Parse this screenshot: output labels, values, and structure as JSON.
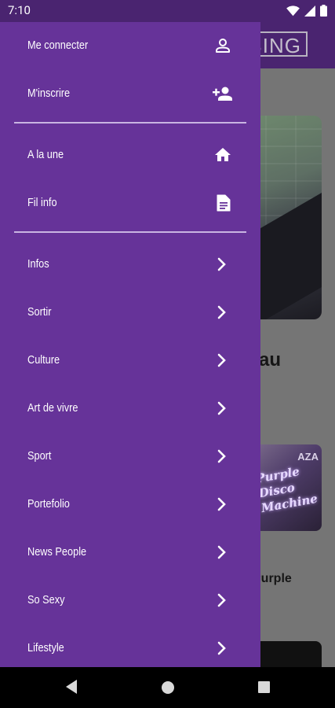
{
  "status_bar": {
    "time": "7:10"
  },
  "background_app": {
    "logo_text": "BING",
    "partial_title": "au",
    "card2_tag": "AZA",
    "card2_neon": "Purple Disco Machine",
    "partial_sub_line1": "Purple",
    "partial_sub_line2": "!"
  },
  "drawer": {
    "account": [
      {
        "label": "Me connecter",
        "icon": "person-icon"
      },
      {
        "label": "M'inscrire",
        "icon": "person-add-icon"
      }
    ],
    "main": [
      {
        "label": "A la une",
        "icon": "home-icon"
      },
      {
        "label": "Fil info",
        "icon": "document-icon"
      }
    ],
    "categories": [
      {
        "label": "Infos"
      },
      {
        "label": "Sortir"
      },
      {
        "label": "Culture"
      },
      {
        "label": "Art de vivre"
      },
      {
        "label": "Sport"
      },
      {
        "label": "Portefolio"
      },
      {
        "label": "News People"
      },
      {
        "label": "So Sexy"
      },
      {
        "label": "Lifestyle"
      }
    ]
  },
  "colors": {
    "drawer_bg": "#663399",
    "header_bg": "#4a2470",
    "divider": "#c9b5e2"
  }
}
